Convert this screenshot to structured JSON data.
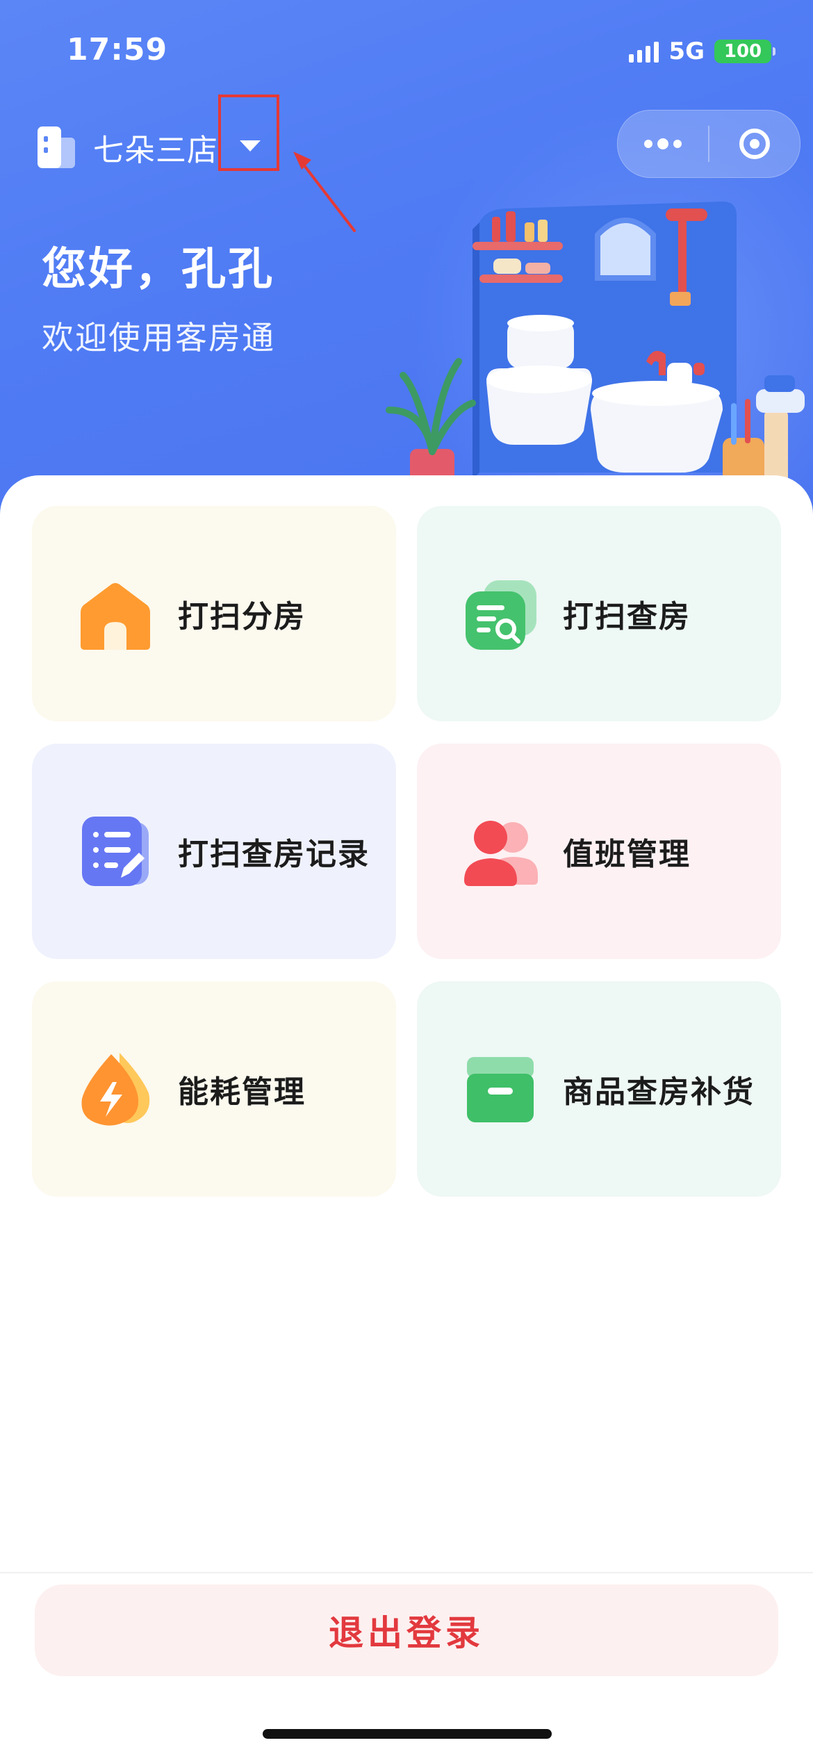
{
  "status_bar": {
    "time": "17:59",
    "network": "5G",
    "battery": "100"
  },
  "header": {
    "store_name": "七朵三店",
    "greeting": "您好，孔孔",
    "welcome": "欢迎使用客房通"
  },
  "menu": {
    "tiles": [
      {
        "label": "打扫分房",
        "icon": "house-icon",
        "bg": "#fcf9ee"
      },
      {
        "label": "打扫查房",
        "icon": "document-search-icon",
        "bg": "#eef8f5"
      },
      {
        "label": "打扫查房记录",
        "icon": "notepad-edit-icon",
        "bg": "#eff2fd"
      },
      {
        "label": "值班管理",
        "icon": "users-icon",
        "bg": "#fdf1f3"
      },
      {
        "label": "能耗管理",
        "icon": "energy-drop-icon",
        "bg": "#fcf9ee"
      },
      {
        "label": "商品查房补货",
        "icon": "archive-box-icon",
        "bg": "#eef8f5"
      }
    ]
  },
  "footer": {
    "logout_label": "退出登录"
  },
  "colors": {
    "hero_blue": "#4f7bf4",
    "logout_red": "#e2393e",
    "annotation_red": "#e53935"
  }
}
